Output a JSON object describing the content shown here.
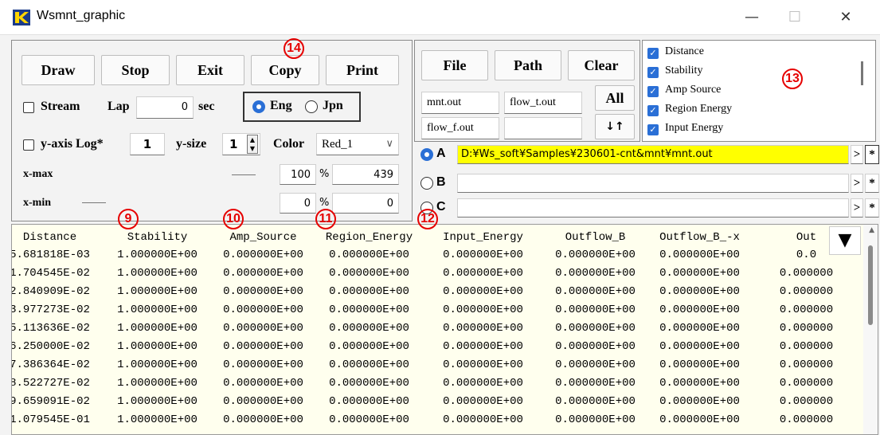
{
  "window": {
    "title": "Wsmnt_graphic",
    "minimize": "—",
    "maximize": "☐",
    "close": "✕"
  },
  "controls": {
    "draw": "Draw",
    "stop": "Stop",
    "exit": "Exit",
    "copy": "Copy",
    "print": "Print",
    "stream_label": "Stream",
    "lap_label": "Lap",
    "lap_value": "0",
    "sec_label": "sec",
    "eng_label": "Eng",
    "jpn_label": "Jpn",
    "ylog_label": "y-axis Log*",
    "ylog_value": "1",
    "ysize_label": "y-size",
    "ysize_value": "1",
    "color_label": "Color",
    "color_value": "Red_1",
    "xmax_label": "x-max",
    "xmax_percent": "100",
    "xmax_value": "439",
    "xmin_label": "x-min",
    "xmin_percent": "0",
    "xmin_value": "0",
    "percent": "%"
  },
  "files": {
    "file": "File",
    "path": "Path",
    "clear": "Clear",
    "mnt_out": "mnt.out",
    "flow_t_out": "flow_t.out",
    "all": "All",
    "flow_f_out": "flow_f.out",
    "flow_f_value": "",
    "swap": "↓↑",
    "a_label": "A",
    "a_path": "D:¥Ws_soft¥Samples¥230601-cnt&mnt¥mnt.out",
    "b_label": "B",
    "c_label": "C",
    "arrow": ">",
    "star": "*"
  },
  "series_list": [
    "Distance",
    "Stability",
    "Amp Source",
    "Region Energy",
    "Input Energy"
  ],
  "callouts": {
    "c9": "9",
    "c10": "10",
    "c11": "11",
    "c12": "12",
    "c13": "13",
    "c14": "14"
  },
  "table": {
    "headers": [
      "Distance",
      "Stability",
      "Amp_Source",
      "Region_Energy",
      "Input_Energy",
      "Outflow_B",
      "Outflow_B_-x",
      "Out"
    ],
    "rows": [
      [
        "5.681818E-03",
        "1.000000E+00",
        "0.000000E+00",
        "0.000000E+00",
        "0.000000E+00",
        "0.000000E+00",
        "0.000000E+00",
        "0.0"
      ],
      [
        "1.704545E-02",
        "1.000000E+00",
        "0.000000E+00",
        "0.000000E+00",
        "0.000000E+00",
        "0.000000E+00",
        "0.000000E+00",
        "0.000000"
      ],
      [
        "2.840909E-02",
        "1.000000E+00",
        "0.000000E+00",
        "0.000000E+00",
        "0.000000E+00",
        "0.000000E+00",
        "0.000000E+00",
        "0.000000"
      ],
      [
        "3.977273E-02",
        "1.000000E+00",
        "0.000000E+00",
        "0.000000E+00",
        "0.000000E+00",
        "0.000000E+00",
        "0.000000E+00",
        "0.000000"
      ],
      [
        "5.113636E-02",
        "1.000000E+00",
        "0.000000E+00",
        "0.000000E+00",
        "0.000000E+00",
        "0.000000E+00",
        "0.000000E+00",
        "0.000000"
      ],
      [
        "6.250000E-02",
        "1.000000E+00",
        "0.000000E+00",
        "0.000000E+00",
        "0.000000E+00",
        "0.000000E+00",
        "0.000000E+00",
        "0.000000"
      ],
      [
        "7.386364E-02",
        "1.000000E+00",
        "0.000000E+00",
        "0.000000E+00",
        "0.000000E+00",
        "0.000000E+00",
        "0.000000E+00",
        "0.000000"
      ],
      [
        "8.522727E-02",
        "1.000000E+00",
        "0.000000E+00",
        "0.000000E+00",
        "0.000000E+00",
        "0.000000E+00",
        "0.000000E+00",
        "0.000000"
      ],
      [
        "9.659091E-02",
        "1.000000E+00",
        "0.000000E+00",
        "0.000000E+00",
        "0.000000E+00",
        "0.000000E+00",
        "0.000000E+00",
        "0.000000"
      ],
      [
        "1.079545E-01",
        "1.000000E+00",
        "0.000000E+00",
        "0.000000E+00",
        "0.000000E+00",
        "0.000000E+00",
        "0.000000E+00",
        "0.000000"
      ]
    ]
  },
  "colors": {
    "highlight": "#ffff00",
    "table_bg": "#ffffee",
    "accent": "#2a6fd6",
    "callout": "#e60000"
  }
}
